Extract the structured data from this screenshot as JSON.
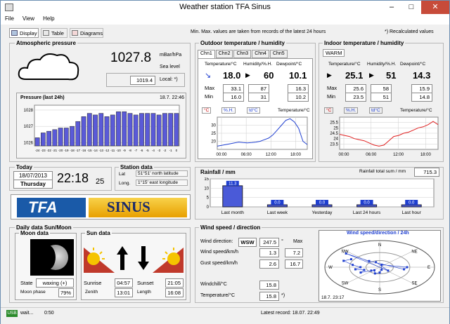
{
  "window": {
    "title": "Weather station TFA Sinus",
    "min": "–",
    "max": "□",
    "close": "✕"
  },
  "menu": [
    "File",
    "View",
    "Help"
  ],
  "toolbar": {
    "display": "Display",
    "table": "Table",
    "diagrams": "Diagrams",
    "note_minmax": "Min. Max. values are taken from records of the latest 24 hours",
    "note_recalc": "*) Recalculated values"
  },
  "pressure": {
    "title": "Atmospheric pressure",
    "value": "1027.8",
    "unit": "mBar/hPa",
    "sea": "Sea level",
    "local_value": "1019.4",
    "local_label": "Local: *)",
    "chart_title": "Pressure (last 24h)",
    "chart_time": "18.7. 22:46",
    "yticks": [
      "1028",
      "1027",
      "1026"
    ],
    "xticks": [
      "-24",
      "-23",
      "-22",
      "-21",
      "-20",
      "-19",
      "-18",
      "-17",
      "-16",
      "-15",
      "-14",
      "-13",
      "-12",
      "-11",
      "-10",
      "-9",
      "-8",
      "-7",
      "-6",
      "-5",
      "-4",
      "-3",
      "-2",
      "-1",
      "0"
    ]
  },
  "chart_data": [
    {
      "type": "bar",
      "title": "Pressure (last 24h)",
      "categories": [
        "-24",
        "-23",
        "-22",
        "-21",
        "-20",
        "-19",
        "-18",
        "-17",
        "-16",
        "-15",
        "-14",
        "-13",
        "-12",
        "-11",
        "-10",
        "-9",
        "-8",
        "-7",
        "-6",
        "-5",
        "-4",
        "-3",
        "-2",
        "-1",
        "0"
      ],
      "values": [
        1026.3,
        1026.6,
        1026.7,
        1026.8,
        1026.9,
        1026.9,
        1027.0,
        1027.3,
        1027.6,
        1027.8,
        1027.7,
        1027.8,
        1027.6,
        1027.7,
        1027.9,
        1027.9,
        1027.8,
        1027.7,
        1027.8,
        1027.8,
        1027.8,
        1027.7,
        1027.8,
        1027.8,
        1027.8
      ],
      "ylim": [
        1025.8,
        1028.3
      ],
      "xlabel": "",
      "ylabel": ""
    },
    {
      "type": "line",
      "title": "",
      "x": [
        "00:00",
        "06:00",
        "12:00",
        "18:00"
      ],
      "values": [
        17,
        17.5,
        18,
        18.5,
        19,
        19.5,
        19.2,
        19,
        19.2,
        19.5,
        20,
        21,
        22,
        24,
        27,
        30,
        33,
        34,
        32,
        28,
        20,
        18
      ],
      "ylim": [
        15,
        35
      ]
    },
    {
      "type": "line",
      "title": "",
      "x": [
        "00:00",
        "06:00",
        "12:00",
        "18:00"
      ],
      "values": [
        24.4,
        24.3,
        24.2,
        24.0,
        23.9,
        23.8,
        23.6,
        23.4,
        23.3,
        23.4,
        23.8,
        24.2,
        24.3,
        24.5,
        24.6,
        24.8,
        25.0,
        25.1,
        25.3,
        25.6,
        25.3
      ],
      "ylim": [
        23,
        26
      ]
    },
    {
      "type": "bar",
      "title": "",
      "categories": [
        "Last month",
        "Last week",
        "Yesterday",
        "Last 24 hours",
        "Last hour"
      ],
      "values": [
        11.3,
        0.0,
        0.0,
        0.0,
        0.0
      ],
      "ylim": [
        0,
        15
      ]
    }
  ],
  "outdoor": {
    "title": "Outdoor temperature / humidity",
    "channels": [
      "Chn1",
      "Chn2",
      "Chn3",
      "Chn4",
      "Chn5"
    ],
    "col_temp": "Temperature/°C",
    "col_hum": "Humidity/%.H.",
    "col_dew": "Dewpoint/°C",
    "temp": "18.0",
    "hum": "60",
    "dew": "10.1",
    "max_label": "Max",
    "min_label": "Min",
    "max_temp": "33.1",
    "max_hum": "87",
    "max_dew": "16.3",
    "min_temp": "16.0",
    "min_hum": "31",
    "min_dew": "10.2",
    "chart_label": "Temperature/°C",
    "yticks": [
      "30",
      "25",
      "20"
    ],
    "xticks": [
      "00:00",
      "06:00",
      "12:00",
      "18:00"
    ],
    "t_icon": "°C",
    "h_icon": "%.H.",
    "d_icon": "td°C"
  },
  "indoor": {
    "title": "Indoor temperature / humidity",
    "warm": "WARM",
    "col_temp": "Temperature/°C",
    "col_hum": "Humidity/%.H.",
    "col_dew": "Dewpoint/°C",
    "temp": "25.1",
    "hum": "51",
    "dew": "14.3",
    "max_label": "Max",
    "min_label": "Min",
    "max_temp": "25.6",
    "max_hum": "58",
    "max_dew": "15.9",
    "min_temp": "23.5",
    "min_hum": "51",
    "min_dew": "14.8",
    "chart_label": "Temperature/°C",
    "yticks": [
      "25.5",
      "25",
      "24.5",
      "24",
      "23.5"
    ],
    "xticks": [
      "00:00",
      "06:00",
      "12:00",
      "18:00"
    ],
    "t_icon": "°C",
    "h_icon": "%.H.",
    "d_icon": "td°C"
  },
  "today": {
    "title": "Today",
    "date": "18/07/2013",
    "weekday": "Thursday",
    "time": "22:18",
    "seconds": "25"
  },
  "station": {
    "title": "Station data",
    "lat_label": "Lat",
    "lat": "51°51' north latitude",
    "long_label": "Long.",
    "long": "1°15' east longitude"
  },
  "banner": {
    "brand": "TFA",
    "model": "SINUS"
  },
  "rain": {
    "title": "Rainfall / mm",
    "total_label": "Rainfall total sum / mm",
    "total": "715.3",
    "yticks": [
      "15",
      "10",
      "5",
      "0"
    ],
    "categories": [
      "Last month",
      "Last week",
      "Yesterday",
      "Last 24 hours",
      "Last hour"
    ],
    "labels": [
      "11.3",
      "0.0",
      "0.0",
      "0.0",
      "0.0"
    ]
  },
  "sunmoon": {
    "title": "Daily data Sun/Moon",
    "moon_title": "Moon data",
    "sun_title": "Sun data",
    "state_label": "State",
    "state": "waxing (+)",
    "phase_label": "Moon phase",
    "phase": "79%",
    "sunrise_label": "Sunrise",
    "sunrise": "04:57",
    "sunset_label": "Sunset",
    "sunset": "21:05",
    "zenith_label": "Zenith",
    "zenith": "13:01",
    "length_label": "Length",
    "length": "16:08"
  },
  "wind": {
    "title": "Wind speed / direction",
    "dir_label": "Wind direction:",
    "dir": "WSW",
    "deg": "247.5",
    "deg_unit": "°",
    "max_label": "Max",
    "speed_label": "Wind speed/km/h",
    "speed": "1.3",
    "speed_max": "7.2",
    "gust_label": "Gust speed/km/h",
    "gust": "2.6",
    "gust_max": "16.7",
    "chill_label": "Windchill/°C",
    "chill": "15.8",
    "temp_label": "Temperature/°C",
    "temp": "15.8",
    "temp_note": "*)",
    "rose_title": "Wind speed/direction / 24h",
    "rose_time": "18.7. 23:17",
    "dirs": [
      "N",
      "NE",
      "E",
      "SE",
      "S",
      "SW",
      "W",
      "NW"
    ]
  },
  "status": {
    "usb": "USB",
    "wait": "wait...",
    "counter": "0:50",
    "latest": "Latest record: 18.07. 22:49"
  }
}
